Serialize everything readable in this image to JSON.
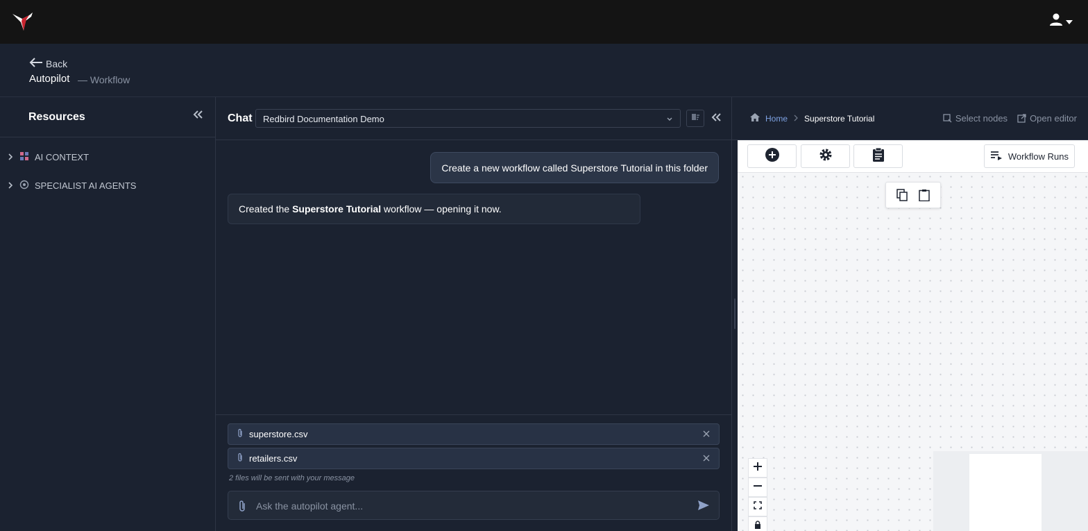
{
  "header": {
    "back_label": "Back",
    "title": "Autopilot",
    "subtitle": "— Workflow"
  },
  "resources": {
    "title": "Resources",
    "items": [
      {
        "label": "AI CONTEXT"
      },
      {
        "label": "SPECIALIST AI AGENTS"
      }
    ]
  },
  "chat": {
    "label": "Chat",
    "selected_conversation": "Redbird Documentation Demo",
    "messages": {
      "user": "Create a new workflow called Superstore Tutorial in this folder",
      "bot_prefix": "Created the ",
      "bot_bold": "Superstore Tutorial",
      "bot_suffix": " workflow — opening it now."
    },
    "attachments": [
      {
        "name": "superstore.csv"
      },
      {
        "name": "retailers.csv"
      }
    ],
    "files_note": "2 files will be sent with your message",
    "input_placeholder": "Ask the autopilot agent..."
  },
  "editor": {
    "breadcrumb": {
      "home": "Home",
      "current": "Superstore Tutorial"
    },
    "select_nodes_label": "Select nodes",
    "open_editor_label": "Open editor",
    "workflow_runs_label": "Workflow Runs"
  },
  "colors": {
    "topbar": "#141414",
    "panel": "#1b2230",
    "accent_link": "#7ea2e3",
    "logo_red": "#c8242f",
    "canvas": "#f5f6f8"
  }
}
